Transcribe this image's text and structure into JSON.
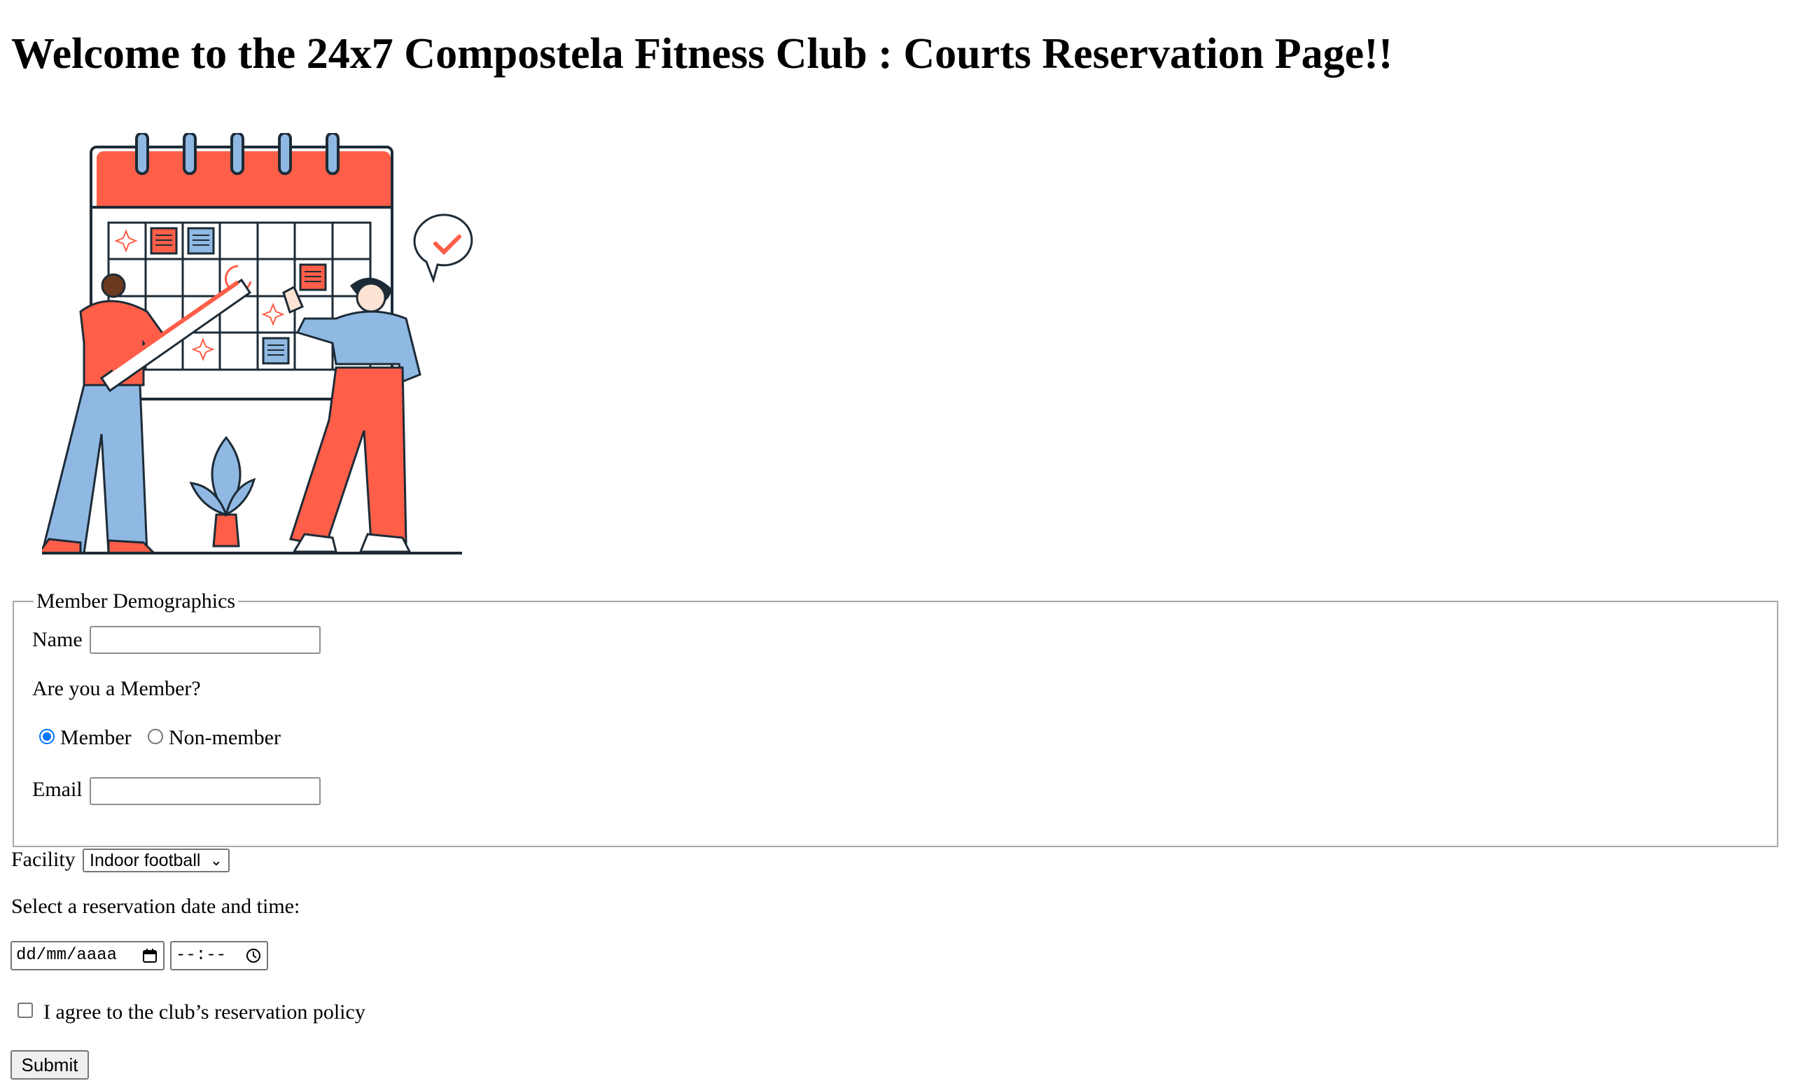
{
  "page": {
    "title": "Welcome to the 24x7 Compostela Fitness Club : Courts Reservation Page!!"
  },
  "illustration": {
    "icon": "calendar-scheduling-illustration",
    "colors": {
      "accent": "#ff5e48",
      "blue": "#8fb9e3",
      "outline": "#1d2b36"
    }
  },
  "demographics": {
    "legend": "Member Demographics",
    "name_label": "Name",
    "name_value": "",
    "member_question": "Are you a Member?",
    "member_option": "Member",
    "nonmember_option": "Non-member",
    "selected": "Member",
    "email_label": "Email",
    "email_value": ""
  },
  "facility": {
    "label": "Facility",
    "selected": "Indoor football"
  },
  "reservation": {
    "prompt": "Select a reservation date and time:",
    "date_placeholder": "dd/mm/aaaa",
    "time_placeholder": "--:--"
  },
  "policy": {
    "label": "I agree to the club’s reservation policy",
    "checked": false
  },
  "submit_label": "Submit",
  "colors": {
    "radio_checked": "#0075ff",
    "field_border": "#8f8f8f"
  }
}
